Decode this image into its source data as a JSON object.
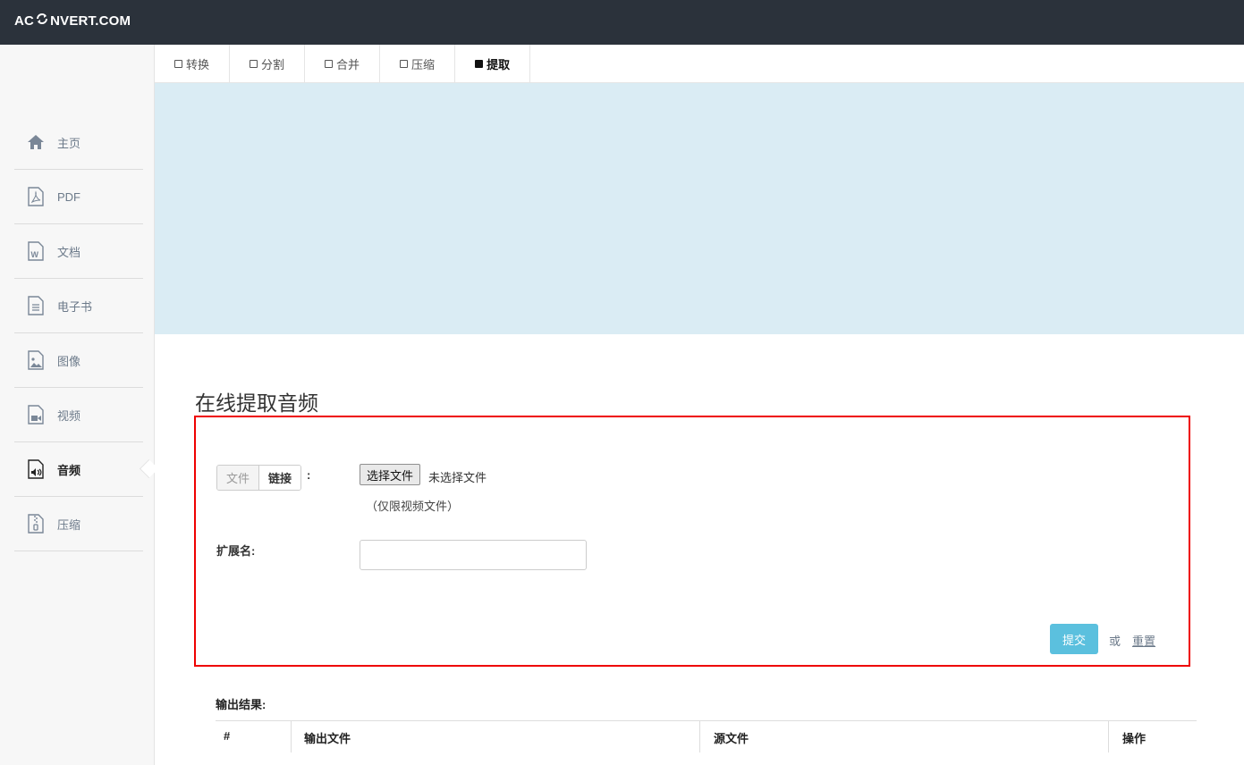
{
  "header": {
    "logo_left": "AC",
    "logo_right": "NVERT.COM"
  },
  "tabs": [
    {
      "label": "转换"
    },
    {
      "label": "分割"
    },
    {
      "label": "合并"
    },
    {
      "label": "压缩"
    },
    {
      "label": "提取",
      "active": true
    }
  ],
  "sidebar": {
    "items": [
      {
        "label": "主页",
        "icon": "home-icon"
      },
      {
        "label": "PDF",
        "icon": "pdf-icon"
      },
      {
        "label": "文档",
        "icon": "word-doc-icon"
      },
      {
        "label": "电子书",
        "icon": "ebook-icon"
      },
      {
        "label": "图像",
        "icon": "image-icon"
      },
      {
        "label": "视频",
        "icon": "video-icon"
      },
      {
        "label": "音频",
        "icon": "audio-icon",
        "active": true
      },
      {
        "label": "压缩",
        "icon": "archive-icon"
      }
    ]
  },
  "main": {
    "title": "在线提取音频",
    "form": {
      "source_toggle": {
        "file": "文件",
        "link": "链接"
      },
      "colon": ":",
      "choose_file": "选择文件",
      "no_file": "未选择文件",
      "hint": "（仅限视频文件）",
      "ext_label": "扩展名:",
      "ext_value": "",
      "submit": "提交",
      "or": "或",
      "reset": "重置"
    },
    "output": {
      "label": "输出结果:",
      "columns": [
        "#",
        "输出文件",
        "源文件",
        "操作"
      ]
    }
  },
  "colors": {
    "topbar": "#2b323b",
    "banner": "#daecf4",
    "submit": "#5bc0de",
    "highlight_border": "#ee0000"
  }
}
